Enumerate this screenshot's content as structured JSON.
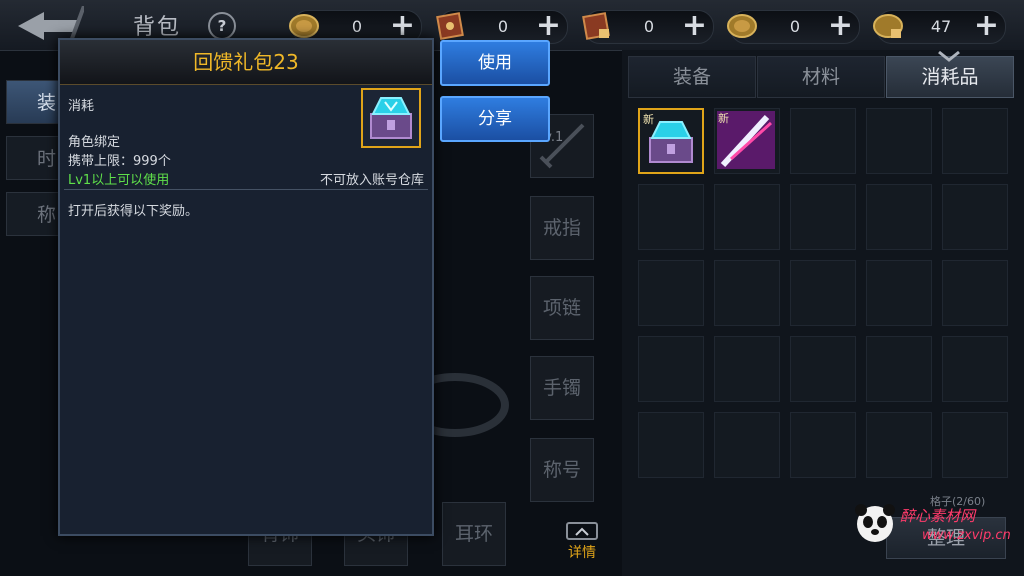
{
  "header": {
    "title": "背包",
    "help_label": "?"
  },
  "currencies": [
    {
      "icon": "gold-coin-icon",
      "value": "0"
    },
    {
      "icon": "scroll-icon",
      "value": "0"
    },
    {
      "icon": "locked-scroll-icon",
      "value": "0"
    },
    {
      "icon": "coin-icon",
      "value": "0"
    },
    {
      "icon": "locked-coin-icon",
      "value": "47"
    }
  ],
  "plus_label": "+",
  "tabs": [
    "装备",
    "材料",
    "消耗品"
  ],
  "active_tab": "消耗品",
  "inventory": {
    "items": [
      {
        "badge": "新",
        "icon": "gift-chest-icon",
        "selected": true
      },
      {
        "badge": "新",
        "icon": "blade-skill-icon",
        "selected": false
      }
    ],
    "count_label": "格子(2/60)",
    "sort_label": "整理"
  },
  "equip_slots": {
    "weapon_level": "Lv.1",
    "labels": [
      "戒指",
      "项链",
      "手镯",
      "称号"
    ],
    "bottom_labels": [
      "背饰",
      "头饰",
      "耳环"
    ]
  },
  "left_tabs": [
    "装",
    "时",
    "称"
  ],
  "details_label": "详情",
  "popup": {
    "title": "回馈礼包23",
    "type": "消耗",
    "bind": "角色绑定",
    "carry_limit": "携带上限：999个",
    "level_req": "Lv1以上可以使用",
    "warehouse_note": "不可放入账号仓库",
    "description": "打开后获得以下奖励。"
  },
  "buttons": {
    "use": "使用",
    "share": "分享"
  },
  "watermark": {
    "text": "醉心素材网",
    "url": "www.zxvip.cn"
  },
  "colors": {
    "gold_title": "#f0b828",
    "green_req": "#5fe04a",
    "button_blue": "#2f7de0",
    "selected_border": "#e0a419"
  }
}
